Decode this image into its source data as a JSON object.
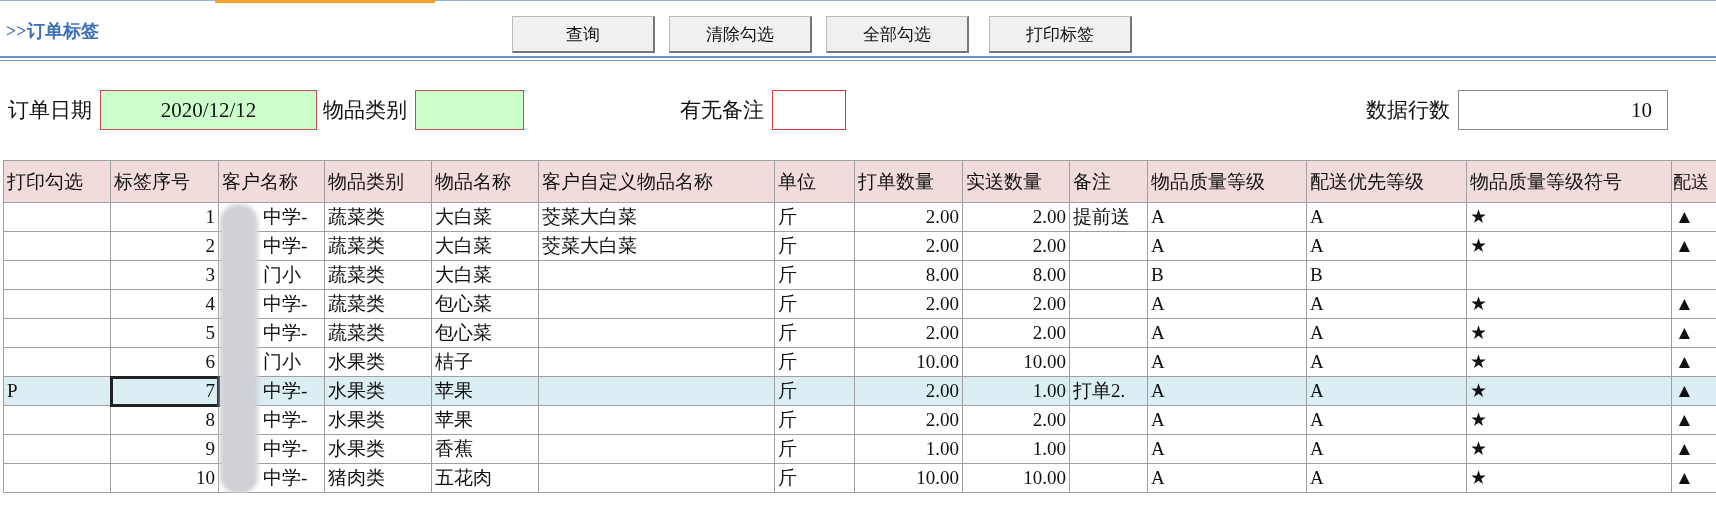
{
  "title": ">>订单标签",
  "buttons": [
    {
      "label": "查询"
    },
    {
      "label": "清除勾选"
    },
    {
      "label": "全部勾选"
    },
    {
      "label": "打印标签"
    }
  ],
  "filters": [
    {
      "kind": "date",
      "label": "订单日期",
      "value": "2020/12/12"
    },
    {
      "kind": "category",
      "label": "物品类别"
    },
    {
      "kind": "remark",
      "label": "有无备注"
    },
    {
      "kind": "count",
      "label": "数据行数",
      "value": "10"
    }
  ],
  "table": {
    "columns": [
      {
        "label": "打印勾选",
        "kind": "text"
      },
      {
        "label": "标签序号",
        "kind": "number"
      },
      {
        "label": "客户名称",
        "kind": "blurred"
      },
      {
        "label": "物品类别",
        "kind": "text"
      },
      {
        "label": "物品名称",
        "kind": "text"
      },
      {
        "label": "客户自定义物品名称",
        "kind": "text"
      },
      {
        "label": "单位",
        "kind": "text"
      },
      {
        "label": "打单数量",
        "kind": "number"
      },
      {
        "label": "实送数量",
        "kind": "number"
      },
      {
        "label": "备注",
        "kind": "text"
      },
      {
        "label": "物品质量等级",
        "kind": "text"
      },
      {
        "label": "配送优先等级",
        "kind": "text"
      },
      {
        "label": "物品质量等级符号",
        "kind": "text"
      },
      {
        "label": "配送",
        "kind": "text"
      }
    ],
    "rows": [
      {
        "selected": false,
        "focused": false,
        "cells": [
          null,
          "1",
          "中学-",
          "蔬菜类",
          "大白菜",
          "茭菜大白菜",
          "斤",
          "2.00",
          "2.00",
          "提前送",
          "A",
          "A",
          "★",
          "▲"
        ]
      },
      {
        "selected": false,
        "focused": false,
        "cells": [
          null,
          "2",
          "中学-",
          "蔬菜类",
          "大白菜",
          "茭菜大白菜",
          "斤",
          "2.00",
          "2.00",
          null,
          "A",
          "A",
          "★",
          "▲"
        ]
      },
      {
        "selected": false,
        "focused": false,
        "cells": [
          null,
          "3",
          "门小",
          "蔬菜类",
          "大白菜",
          null,
          "斤",
          "8.00",
          "8.00",
          null,
          "B",
          "B",
          null,
          null
        ]
      },
      {
        "selected": false,
        "focused": false,
        "cells": [
          null,
          "4",
          "中学-",
          "蔬菜类",
          "包心菜",
          null,
          "斤",
          "2.00",
          "2.00",
          null,
          "A",
          "A",
          "★",
          "▲"
        ]
      },
      {
        "selected": false,
        "focused": false,
        "cells": [
          null,
          "5",
          "中学-",
          "蔬菜类",
          "包心菜",
          null,
          "斤",
          "2.00",
          "2.00",
          null,
          "A",
          "A",
          "★",
          "▲"
        ]
      },
      {
        "selected": false,
        "focused": false,
        "cells": [
          null,
          "6",
          "门小",
          "水果类",
          "桔子",
          null,
          "斤",
          "10.00",
          "10.00",
          null,
          "A",
          "A",
          "★",
          "▲"
        ]
      },
      {
        "selected": true,
        "focused": true,
        "cells": [
          "P",
          "7",
          "中学-",
          "水果类",
          "苹果",
          null,
          "斤",
          "2.00",
          "1.00",
          "打单2.",
          "A",
          "A",
          "★",
          "▲"
        ]
      },
      {
        "selected": false,
        "focused": false,
        "cells": [
          null,
          "8",
          "中学-",
          "水果类",
          "苹果",
          null,
          "斤",
          "2.00",
          "2.00",
          null,
          "A",
          "A",
          "★",
          "▲"
        ]
      },
      {
        "selected": false,
        "focused": false,
        "cells": [
          null,
          "9",
          "中学-",
          "水果类",
          "香蕉",
          null,
          "斤",
          "1.00",
          "1.00",
          null,
          "A",
          "A",
          "★",
          "▲"
        ]
      },
      {
        "selected": false,
        "focused": false,
        "cells": [
          null,
          "10",
          "中学-",
          "猪肉类",
          "五花肉",
          null,
          "斤",
          "10.00",
          "10.00",
          null,
          "A",
          "A",
          "★",
          "▲"
        ]
      }
    ]
  }
}
